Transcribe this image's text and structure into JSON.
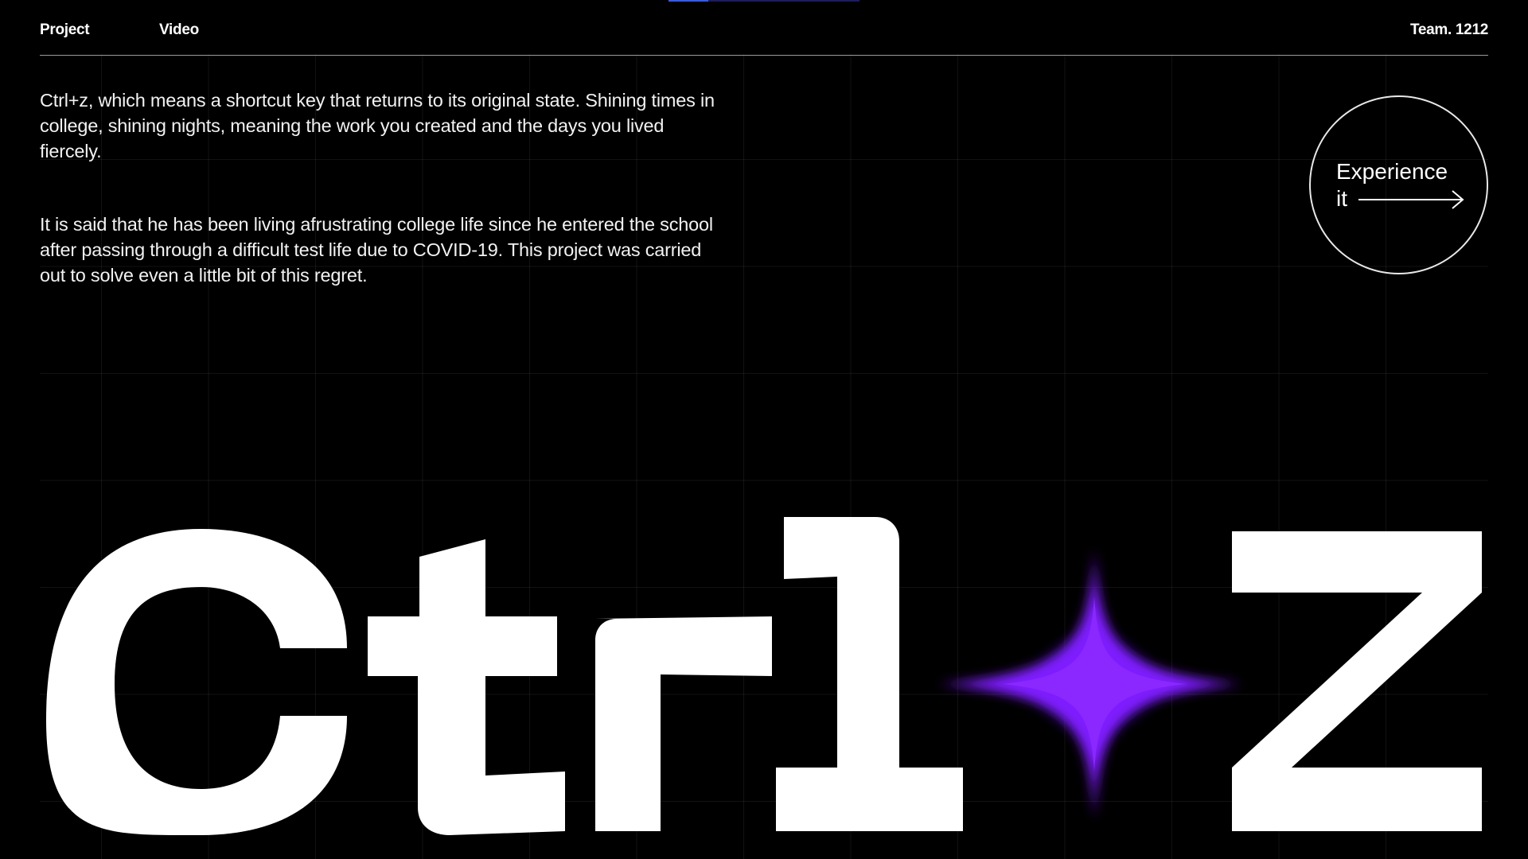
{
  "header": {
    "nav": [
      {
        "label": "Project"
      },
      {
        "label": "Video"
      }
    ],
    "team": "Team. 1212"
  },
  "intro": {
    "paragraph1": "Ctrl+z, which means a shortcut key that returns to its original state. Shining times in college, shining nights, meaning the work you created and the days you lived fiercely.",
    "paragraph2": "It is said that he has been living afrustrating college life since he entered the school after passing through a difficult test life due to COVID-19. This project was carried out to solve even a little bit of this regret."
  },
  "experience": {
    "line1": "Experience",
    "line2": "it",
    "icon": "arrow-right-icon"
  },
  "logo": {
    "left": "Ctrl",
    "right": "Z",
    "separator_icon": "sparkle-star-icon"
  },
  "colors": {
    "background": "#000000",
    "text": "#ffffff",
    "accent_violet": "#8a1cff",
    "accent_blue": "#3b2cff",
    "indicator": "#3d5bd9"
  }
}
